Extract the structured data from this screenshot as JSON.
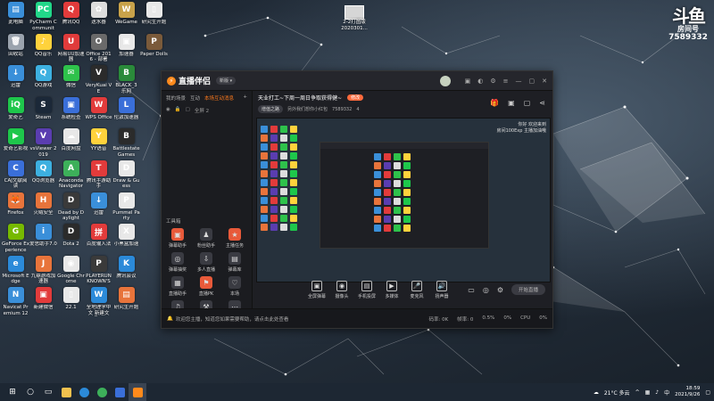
{
  "desktop": {
    "icons": [
      {
        "label": "此电脑",
        "color": "#3a8fd9",
        "glyph": "▤"
      },
      {
        "label": "PyCharm Community...",
        "color": "#21d789",
        "glyph": "PC"
      },
      {
        "label": "腾讯QQ",
        "color": "#e23b3b",
        "glyph": "Q"
      },
      {
        "label": "送水器",
        "color": "#dddddd",
        "glyph": "✿"
      },
      {
        "label": "WeGame",
        "color": "#c8a24a",
        "glyph": "W"
      },
      {
        "label": "研究生开题",
        "color": "#e8e8e8",
        "glyph": "▯"
      },
      {
        "label": "回收站",
        "color": "#9aa3ad",
        "glyph": "🗑"
      },
      {
        "label": "QQ音乐",
        "color": "#ffd23c",
        "glyph": "♪"
      },
      {
        "label": "网易UU加速器",
        "color": "#e03b3b",
        "glyph": "U"
      },
      {
        "label": "Office 2016 - 部署",
        "color": "#6a6a6a",
        "glyph": "O"
      },
      {
        "label": "加速器",
        "color": "#e8e8e8",
        "glyph": "▣"
      },
      {
        "label": "Paper Dolls",
        "color": "#7a5a3a",
        "glyph": "P"
      },
      {
        "label": "迅雷",
        "color": "#3a8fd9",
        "glyph": "↓"
      },
      {
        "label": "QQ游戏",
        "color": "#3db0e0",
        "glyph": "Q"
      },
      {
        "label": "微信",
        "color": "#2ec24b",
        "glyph": "✉"
      },
      {
        "label": "VeryKuai VE",
        "color": "#2b2b2b",
        "glyph": "V"
      },
      {
        "label": "BLACK_3 乐网",
        "color": "#2a8a3a",
        "glyph": "B"
      },
      {
        "label": "",
        "color": "transparent",
        "glyph": ""
      },
      {
        "label": "爱奇艺",
        "color": "#1ec74b",
        "glyph": "iQ"
      },
      {
        "label": "Steam",
        "color": "#1b2838",
        "glyph": "S"
      },
      {
        "label": "系统检查",
        "color": "#3a6fd9",
        "glyph": "▣"
      },
      {
        "label": "WPS Office",
        "color": "#e23b3b",
        "glyph": "W"
      },
      {
        "label": "伦敦加速器",
        "color": "#3a6fd9",
        "glyph": "L"
      },
      {
        "label": "",
        "color": "transparent",
        "glyph": ""
      },
      {
        "label": "爱奇艺影视",
        "color": "#1ec74b",
        "glyph": "▶"
      },
      {
        "label": "vsViewer 2019",
        "color": "#5a3db0",
        "glyph": "V"
      },
      {
        "label": "百度网盘",
        "color": "#e8e8e8",
        "glyph": "☁"
      },
      {
        "label": "YY语音",
        "color": "#ffd23c",
        "glyph": "Y"
      },
      {
        "label": "Battlestate Games",
        "color": "#2b2b2b",
        "glyph": "B"
      },
      {
        "label": "",
        "color": "transparent",
        "glyph": ""
      },
      {
        "label": "CAJ文献阅读",
        "color": "#3a6fd9",
        "glyph": "C"
      },
      {
        "label": "QQ浏览器",
        "color": "#3db0e0",
        "glyph": "Q"
      },
      {
        "label": "Anaconda Navigator",
        "color": "#3db05a",
        "glyph": "A"
      },
      {
        "label": "腾讯手游助手",
        "color": "#e23b3b",
        "glyph": "T"
      },
      {
        "label": "Draw & Guess",
        "color": "#e8e8e8",
        "glyph": "D"
      },
      {
        "label": "",
        "color": "transparent",
        "glyph": ""
      },
      {
        "label": "Firefox",
        "color": "#e8743b",
        "glyph": "🦊"
      },
      {
        "label": "火绒安全",
        "color": "#e8743b",
        "glyph": "H"
      },
      {
        "label": "Dead by Daylight",
        "color": "#3a3a3a",
        "glyph": "D"
      },
      {
        "label": "迅雷",
        "color": "#3a8fd9",
        "glyph": "↓"
      },
      {
        "label": "Pummel Party",
        "color": "#e8e8e8",
        "glyph": "P"
      },
      {
        "label": "",
        "color": "transparent",
        "glyph": ""
      },
      {
        "label": "GeForce Experience",
        "color": "#76b900",
        "glyph": "G"
      },
      {
        "label": "爱思助手7.0",
        "color": "#3a8fd9",
        "glyph": "i"
      },
      {
        "label": "Dota 2",
        "color": "#2b2b2b",
        "glyph": "D"
      },
      {
        "label": "百度输入法",
        "color": "#e23b3b",
        "glyph": "拼"
      },
      {
        "label": "小黑盒加速",
        "color": "#e8e8e8",
        "glyph": "X"
      },
      {
        "label": "",
        "color": "transparent",
        "glyph": ""
      },
      {
        "label": "Microsoft Edge",
        "color": "#2b8ad9",
        "glyph": "e"
      },
      {
        "label": "九鼎游戏加速器",
        "color": "#e8743b",
        "glyph": "J"
      },
      {
        "label": "Google Chrome",
        "color": "#e8e8e8",
        "glyph": "◉"
      },
      {
        "label": "PLAYERUNKNOWN'S BATTLEGR...",
        "color": "#3a3a3a",
        "glyph": "P"
      },
      {
        "label": "腾讯会议",
        "color": "#2b8ad9",
        "glyph": "K"
      },
      {
        "label": "",
        "color": "transparent",
        "glyph": ""
      },
      {
        "label": "Navicat Premium 12",
        "color": "#3a8fd9",
        "glyph": "N"
      },
      {
        "label": "新建微信",
        "color": "#e23b3b",
        "glyph": "▣"
      },
      {
        "label": "22.1",
        "color": "#e8e8e8",
        "glyph": "▯"
      },
      {
        "label": "全地理学中文 新建文件...",
        "color": "#2b8ad9",
        "glyph": "W"
      },
      {
        "label": "研究生开题",
        "color": "#e8743b",
        "glyph": "▤"
      },
      {
        "label": "",
        "color": "transparent",
        "glyph": ""
      }
    ],
    "folder_label": "2-2打图版 2020301...",
    "brand": {
      "logo": "斗鱼",
      "room_label": "房间号",
      "room_id": "7589332"
    }
  },
  "app": {
    "title": "直播伴侣",
    "version": "新版 ▾",
    "left_tabs": [
      "我的场景",
      "互动",
      "本场互动消息"
    ],
    "left_status": [
      "全屏 2"
    ],
    "tools_heading": "工具箱",
    "tools": [
      {
        "label": "弹幕助手",
        "color": "#e85a3a",
        "glyph": "▣"
      },
      {
        "label": "粉丝助手",
        "color": "#3a3b42",
        "glyph": "♟"
      },
      {
        "label": "主播任务",
        "color": "#e85a3a",
        "glyph": "★"
      },
      {
        "label": "弹幕抽奖",
        "color": "#3a3b42",
        "glyph": "◎"
      },
      {
        "label": "多人直播",
        "color": "#3a3b42",
        "glyph": "⇩"
      },
      {
        "label": "弹幕库",
        "color": "#3a3b42",
        "glyph": "▤"
      },
      {
        "label": "直播助手",
        "color": "#3a3b42",
        "glyph": "▦"
      },
      {
        "label": "直播PK",
        "color": "#e85a3a",
        "glyph": "⚑"
      },
      {
        "label": "本场",
        "color": "#3a3b42",
        "glyph": "♡"
      },
      {
        "label": "变声器",
        "color": "#3a3b42",
        "glyph": "♫"
      },
      {
        "label": "工具",
        "color": "#3a3b42",
        "glyph": "⚒"
      },
      {
        "label": "更多",
        "color": "#3a3b42",
        "glyph": "⋯"
      }
    ],
    "stream_title": "天业打工~下周一周日争取获得健~",
    "stream_badge": "修改",
    "stream_chip": "增值之路",
    "stream_meta": [
      "另外我们想你小红包",
      "7589332",
      "4"
    ],
    "preview_note": [
      "你好 欢迎来到",
      "房间100Exp 主播加油哦"
    ],
    "bottom_items": [
      {
        "label": "全屏弹幕",
        "glyph": "▣"
      },
      {
        "label": "摄像头",
        "glyph": "◉"
      },
      {
        "label": "手机投屏",
        "glyph": "▤"
      },
      {
        "label": "多媒体",
        "glyph": "▶"
      },
      {
        "label": "麦克风",
        "glyph": "🎤"
      },
      {
        "label": "扬声器",
        "glyph": "🔊"
      }
    ],
    "live_button": "开始直播",
    "status_left": "欢迎您主播，知道您如果需要帮助，请点击此处查看",
    "status_right": [
      "码率: 0K",
      "帧率: 0",
      "0.5%",
      "0%",
      "CPU",
      "0%"
    ]
  },
  "taskbar": {
    "weather": "21°C 多云",
    "time": "18:59",
    "date": "2021/9/26",
    "lang": "中"
  }
}
